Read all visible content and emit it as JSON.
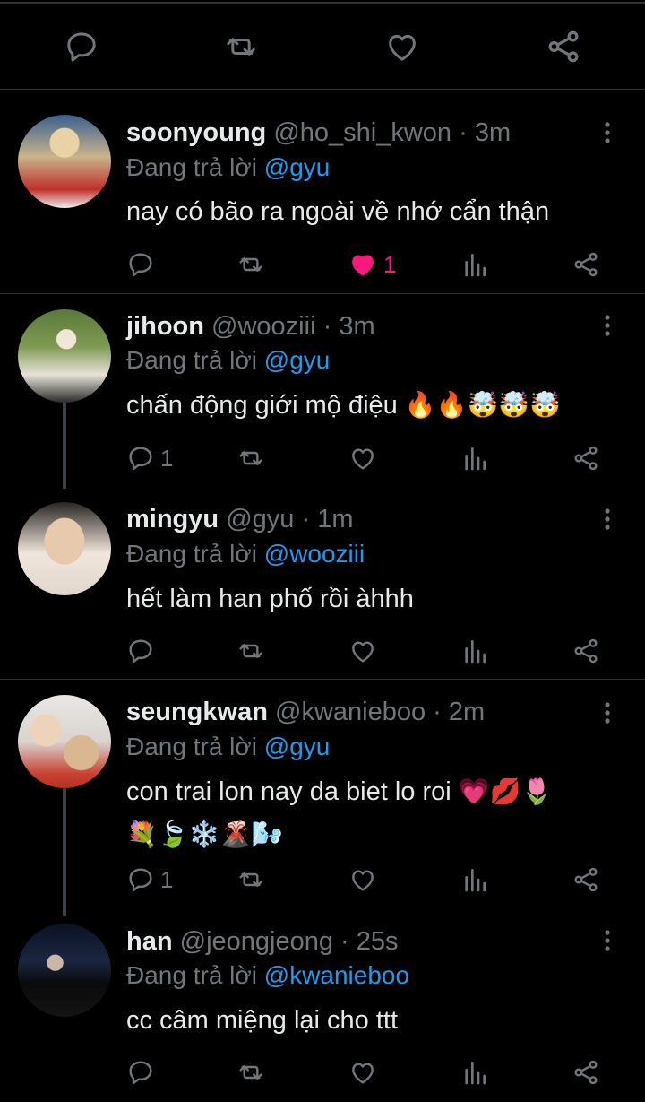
{
  "reply_prefix": "Đang trả lời",
  "tweets": [
    {
      "name": "soonyoung",
      "handle": "@ho_shi_kwon",
      "dot": "·",
      "time": "3m",
      "mention": "@gyu",
      "text": "nay có bão ra ngoài về nhớ cẩn thận",
      "reply_count": "",
      "like_count": "1",
      "liked": true
    },
    {
      "name": "jihoon",
      "handle": "@wooziii",
      "dot": "·",
      "time": "3m",
      "mention": "@gyu",
      "text": "chấn động giới mộ điệu",
      "emoji": "🔥🔥🤯🤯🤯",
      "reply_count": "1",
      "like_count": ""
    },
    {
      "name": "mingyu",
      "handle": "@gyu",
      "dot": "·",
      "time": "1m",
      "mention": "@wooziii",
      "text": "hết làm han phố rồi àhhh",
      "reply_count": "",
      "like_count": ""
    },
    {
      "name": "seungkwan",
      "handle": "@kwanieboo",
      "dot": "·",
      "time": "2m",
      "mention": "@gyu",
      "text": "con trai lon nay da biet lo roi",
      "emoji": "💗💋🌷",
      "emoji_line2": "💐🍃❄️🌋🌬️",
      "reply_count": "1",
      "like_count": ""
    },
    {
      "name": "han",
      "handle": "@jeongjeong",
      "dot": "·",
      "time": "25s",
      "mention": "@kwanieboo",
      "text": "cc câm miệng lại cho ttt",
      "reply_count": "",
      "like_count": ""
    }
  ],
  "colors": {
    "background": "#000000",
    "muted": "#71767b",
    "accent": "#1d9bf0",
    "like": "#f91880",
    "divider": "#2f3336"
  },
  "icons": [
    "reply-icon",
    "retweet-icon",
    "like-icon",
    "share-icon",
    "views-icon",
    "more-icon"
  ]
}
